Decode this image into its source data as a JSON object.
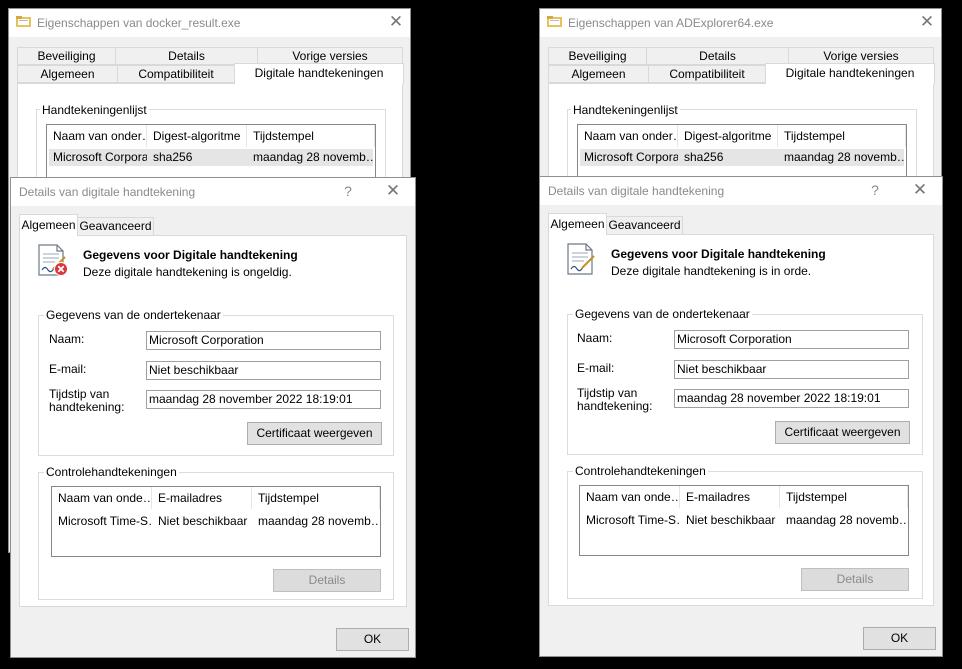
{
  "windows": [
    {
      "id": "left",
      "props": {
        "title": "Eigenschappen van docker_result.exe",
        "tabs_row1": [
          "Beveiliging",
          "Details",
          "Vorige versies"
        ],
        "tabs_row2": [
          "Algemeen",
          "Compatibiliteit",
          "Digitale handtekeningen"
        ],
        "list_group": "Handtekeningenlijst",
        "list_headers": [
          "Naam van onder…",
          "Digest-algoritme",
          "Tijdstempel"
        ],
        "list_row": [
          "Microsoft Corpora…",
          "sha256",
          "maandag 28 novemb…"
        ]
      },
      "dialog": {
        "title": "Details van digitale handtekening",
        "help": "?",
        "close": "✕",
        "tabs": [
          "Algemeen",
          "Geavanceerd"
        ],
        "heading": "Gegevens voor Digitale handtekening",
        "status": "Deze digitale handtekening is ongeldig.",
        "status_valid": false,
        "signer_group": "Gegevens van de ondertekenaar",
        "name_label": "Naam:",
        "name_value": "Microsoft Corporation",
        "email_label": "E-mail:",
        "email_value": "Niet beschikbaar",
        "time_label_1": "Tijdstip van",
        "time_label_2": "handtekening:",
        "time_value": "maandag 28 november 2022 18:19:01",
        "cert_button": "Certificaat weergeven",
        "counter_group": "Controlehandtekeningen",
        "counter_headers": [
          "Naam van onde…",
          "E-mailadres",
          "Tijdstempel"
        ],
        "counter_row": [
          "Microsoft Time-S…",
          "Niet beschikbaar",
          "maandag 28 novemb…"
        ],
        "details_button": "Details",
        "ok_button": "OK"
      }
    },
    {
      "id": "right",
      "props": {
        "title": "Eigenschappen van ADExplorer64.exe",
        "tabs_row1": [
          "Beveiliging",
          "Details",
          "Vorige versies"
        ],
        "tabs_row2": [
          "Algemeen",
          "Compatibiliteit",
          "Digitale handtekeningen"
        ],
        "list_group": "Handtekeningenlijst",
        "list_headers": [
          "Naam van onder…",
          "Digest-algoritme",
          "Tijdstempel"
        ],
        "list_row": [
          "Microsoft Corpora…",
          "sha256",
          "maandag 28 novemb…"
        ]
      },
      "dialog": {
        "title": "Details van digitale handtekening",
        "help": "?",
        "close": "✕",
        "tabs": [
          "Algemeen",
          "Geavanceerd"
        ],
        "heading": "Gegevens voor Digitale handtekening",
        "status": "Deze digitale handtekening is in orde.",
        "status_valid": true,
        "signer_group": "Gegevens van de ondertekenaar",
        "name_label": "Naam:",
        "name_value": "Microsoft Corporation",
        "email_label": "E-mail:",
        "email_value": "Niet beschikbaar",
        "time_label_1": "Tijdstip van",
        "time_label_2": "handtekening:",
        "time_value": "maandag 28 november 2022 18:19:01",
        "cert_button": "Certificaat weergeven",
        "counter_group": "Controlehandtekeningen",
        "counter_headers": [
          "Naam van onde…",
          "E-mailadres",
          "Tijdstempel"
        ],
        "counter_row": [
          "Microsoft Time-S…",
          "Niet beschikbaar",
          "maandag 28 novemb…"
        ],
        "details_button": "Details",
        "ok_button": "OK"
      }
    }
  ],
  "icons": {
    "close": "✕",
    "folder_icon": "folder-icon",
    "cert_icon": "certificate-icon",
    "error_badge": "error-badge-icon"
  },
  "colors": {
    "desktop": "#000000",
    "dialog_body": "#f0f0f0",
    "error_red": "#d9363e",
    "title_gray": "#8a8a8a"
  }
}
